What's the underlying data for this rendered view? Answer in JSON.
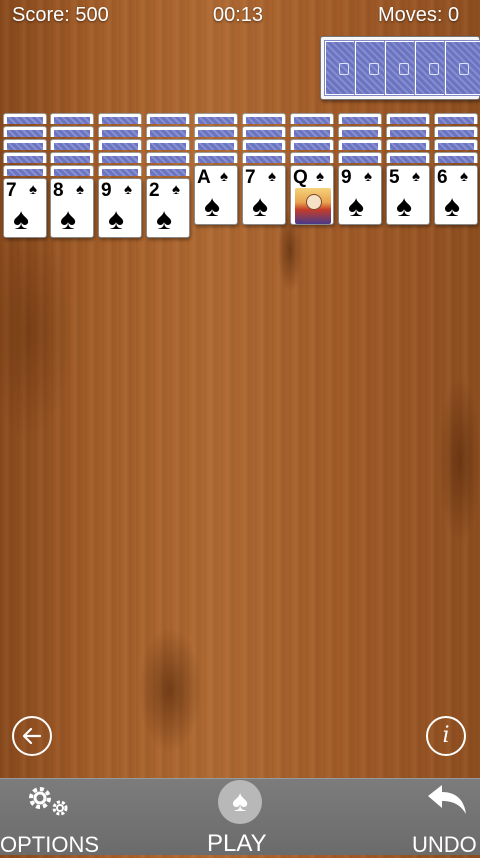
{
  "hud": {
    "score_label": "Score: 500",
    "timer": "00:13",
    "moves_label": "Moves: 0"
  },
  "stock": {
    "remaining_deals": 5
  },
  "tableau": [
    {
      "facedown": 5,
      "rank": "7",
      "suit": "♠"
    },
    {
      "facedown": 5,
      "rank": "8",
      "suit": "♠"
    },
    {
      "facedown": 5,
      "rank": "9",
      "suit": "♠"
    },
    {
      "facedown": 5,
      "rank": "2",
      "suit": "♠"
    },
    {
      "facedown": 4,
      "rank": "A",
      "suit": "♠"
    },
    {
      "facedown": 4,
      "rank": "7",
      "suit": "♠"
    },
    {
      "facedown": 4,
      "rank": "Q",
      "suit": "♠",
      "face_art": true
    },
    {
      "facedown": 4,
      "rank": "9",
      "suit": "♠"
    },
    {
      "facedown": 4,
      "rank": "5",
      "suit": "♠"
    },
    {
      "facedown": 4,
      "rank": "6",
      "suit": "♠"
    }
  ],
  "buttons": {
    "back_icon": "arrow-left-icon",
    "info_icon": "info-icon",
    "info_glyph": "i"
  },
  "bottom_bar": {
    "options_label": "OPTIONS",
    "play_label": "PLAY",
    "undo_label": "UNDO",
    "options_icon": "gears-icon",
    "play_icon": "spade-icon",
    "undo_icon": "undo-arrow-icon"
  },
  "colors": {
    "card_back": "#6a74c2",
    "bottom_bar": "#737373",
    "wood": "#a45e29"
  }
}
